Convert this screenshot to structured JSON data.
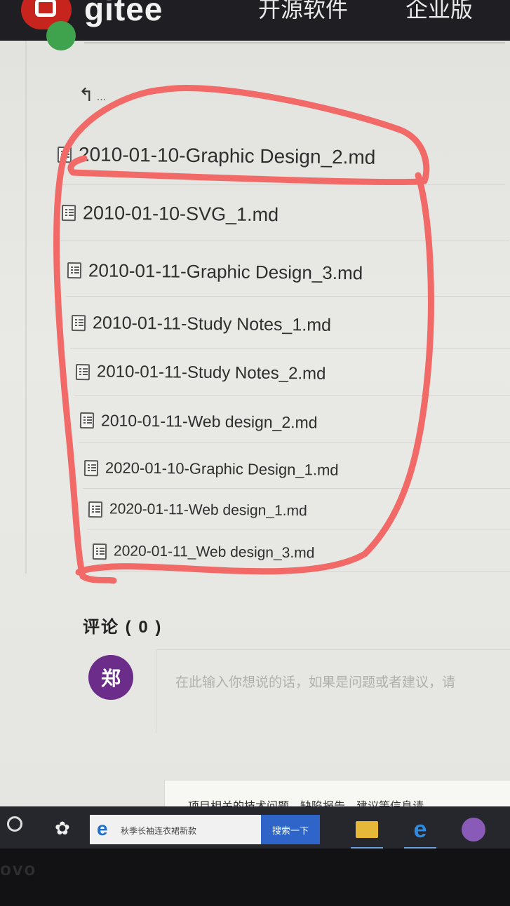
{
  "header": {
    "logo_text": "gitee",
    "nav": [
      "开源软件",
      "企业版"
    ]
  },
  "breadcrumb": {
    "back_label": "..."
  },
  "files": [
    "2010-01-10-Graphic Design_2.md",
    "2010-01-10-SVG_1.md",
    "2010-01-11-Graphic Design_3.md",
    "2010-01-11-Study Notes_1.md",
    "2010-01-11-Study Notes_2.md",
    "2010-01-11-Web design_2.md",
    "2020-01-10-Graphic Design_1.md",
    "2020-01-11-Web design_1.md",
    "2020-01-11_Web design_3.md"
  ],
  "comments": {
    "title": "评论 ( 0 )",
    "avatar_initial": "郑",
    "placeholder": "在此输入你想说的话，如果是问题或者建议，请",
    "notice": "项目相关的技术问题、缺陷报告、建议等信息请"
  },
  "taskbar": {
    "search_query": "秋季长袖连衣裙新款",
    "search_button": "搜索一下",
    "bezel_brand": "ovo"
  },
  "colors": {
    "annotation_red": "#f26a68",
    "brand_red": "#c7241d",
    "avatar_purple": "#6b2c8a"
  }
}
